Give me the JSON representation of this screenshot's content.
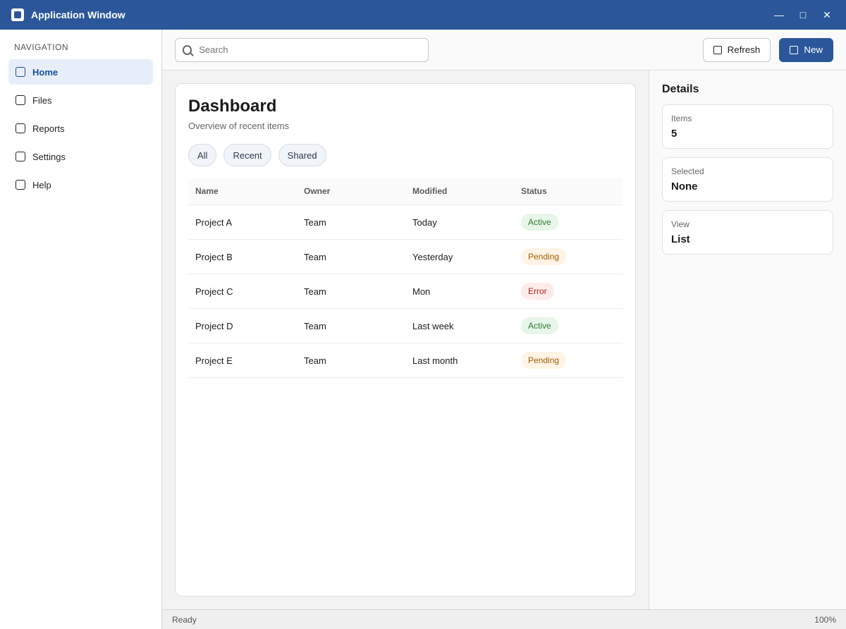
{
  "app": {
    "title": "Application Window",
    "controls": [
      "—",
      "□",
      "✕"
    ]
  },
  "sidebar": {
    "header": "Navigation",
    "items": [
      {
        "label": "Home",
        "icon": "home-icon"
      },
      {
        "label": "Files",
        "icon": "folder-icon"
      },
      {
        "label": "Reports",
        "icon": "chart-icon"
      },
      {
        "label": "Settings",
        "icon": "gear-icon"
      },
      {
        "label": "Help",
        "icon": "help-icon"
      }
    ],
    "active_index": 0
  },
  "toolbar": {
    "search_placeholder": "Search",
    "button_secondary": "Refresh",
    "button_primary": "New"
  },
  "main": {
    "title": "Dashboard",
    "subtitle": "Overview of recent items",
    "chips": [
      "All",
      "Recent",
      "Shared"
    ],
    "table": {
      "headers": [
        "Name",
        "Owner",
        "Modified",
        "Status"
      ],
      "rows": [
        [
          "Project A",
          "Team",
          "Today",
          "Active"
        ],
        [
          "Project B",
          "Team",
          "Yesterday",
          "Pending"
        ],
        [
          "Project C",
          "Team",
          "Mon",
          "Error"
        ],
        [
          "Project D",
          "Team",
          "Last week",
          "Active"
        ],
        [
          "Project E",
          "Team",
          "Last month",
          "Pending"
        ]
      ],
      "status_styles": [
        "ok",
        "warn",
        "err",
        "ok",
        "warn"
      ]
    }
  },
  "right_rail": {
    "title": "Details",
    "boxes": [
      {
        "label": "Items",
        "value": "5"
      },
      {
        "label": "Selected",
        "value": "None"
      },
      {
        "label": "View",
        "value": "List"
      }
    ]
  },
  "statusbar": {
    "left": "Ready",
    "right": "100%"
  },
  "colors": {
    "accent": "#2b579a",
    "surface": "#ffffff",
    "background": "#f3f3f3"
  }
}
